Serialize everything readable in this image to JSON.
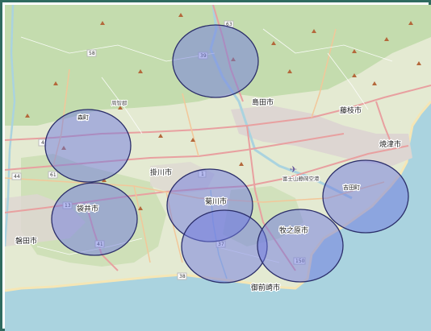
{
  "map": {
    "colors": {
      "sea": "#aad3df",
      "land": "#e4ead2",
      "forest": "#c4dcae",
      "urban": "#ddd6d2",
      "road_major": "#e8a0a0",
      "road_trunk": "#f2c79a",
      "coverage_fill": "#6d78e0",
      "coverage_stroke": "#2b2e6a",
      "frame": "#2f6b60"
    },
    "cities": [
      {
        "id": "shimada",
        "label": "島田市"
      },
      {
        "id": "fujieda",
        "label": "藤枝市"
      },
      {
        "id": "yaizu",
        "label": "焼津市"
      },
      {
        "id": "kakegawa",
        "label": "掛川市"
      },
      {
        "id": "kikugawa",
        "label": "菊川市"
      },
      {
        "id": "fukuroi",
        "label": "袋井市"
      },
      {
        "id": "iwata",
        "label": "磐田市"
      },
      {
        "id": "makinohara",
        "label": "牧之原市"
      },
      {
        "id": "omaezaki",
        "label": "御前崎市"
      },
      {
        "id": "yoshida",
        "label": "吉田町"
      },
      {
        "id": "mori",
        "label": "森町"
      }
    ],
    "small_labels": [
      {
        "id": "shuchi",
        "label": "周智郡"
      },
      {
        "id": "airport",
        "label": "富士山静岡空港"
      }
    ],
    "road_shields": [
      "63",
      "58",
      "39",
      "1",
      "44",
      "61",
      "41",
      "37",
      "38",
      "150",
      "13",
      "4"
    ],
    "coverage_areas": [
      {
        "id": "north",
        "label": "shizuoka-north-circle"
      },
      {
        "id": "mori",
        "label": "mori-circle"
      },
      {
        "id": "fukuroi",
        "label": "fukuroi-circle"
      },
      {
        "id": "kikugawa",
        "label": "kikugawa-circle"
      },
      {
        "id": "kikugawa-south",
        "label": "kikugawa-south-circle"
      },
      {
        "id": "makinohara",
        "label": "makinohara-circle"
      },
      {
        "id": "yoshida",
        "label": "yoshida-circle"
      }
    ]
  }
}
